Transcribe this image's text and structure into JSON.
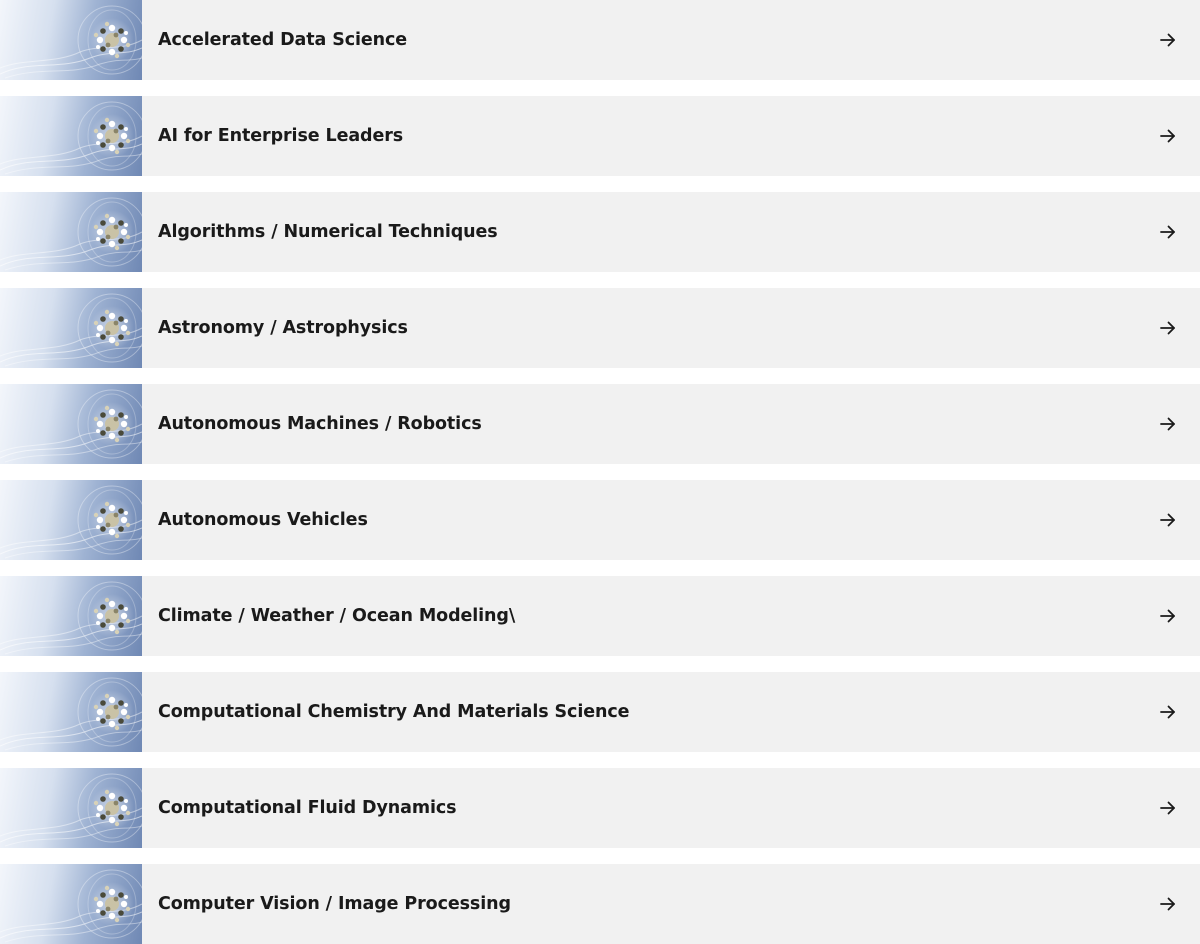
{
  "topics": [
    {
      "label": "Accelerated Data Science",
      "icon": "molecule-thumbnail",
      "action_icon": "arrow-right-icon"
    },
    {
      "label": "AI for Enterprise Leaders",
      "icon": "molecule-thumbnail",
      "action_icon": "arrow-right-icon"
    },
    {
      "label": "Algorithms / Numerical Techniques",
      "icon": "molecule-thumbnail",
      "action_icon": "arrow-right-icon"
    },
    {
      "label": "Astronomy / Astrophysics",
      "icon": "molecule-thumbnail",
      "action_icon": "arrow-right-icon"
    },
    {
      "label": "Autonomous Machines / Robotics",
      "icon": "molecule-thumbnail",
      "action_icon": "arrow-right-icon"
    },
    {
      "label": "Autonomous Vehicles",
      "icon": "molecule-thumbnail",
      "action_icon": "arrow-right-icon"
    },
    {
      "label": "Climate / Weather / Ocean Modeling\\",
      "icon": "molecule-thumbnail",
      "action_icon": "arrow-right-icon"
    },
    {
      "label": "Computational Chemistry And Materials Science",
      "icon": "molecule-thumbnail",
      "action_icon": "arrow-right-icon"
    },
    {
      "label": "Computational Fluid Dynamics",
      "icon": "molecule-thumbnail",
      "action_icon": "arrow-right-icon"
    },
    {
      "label": "Computer Vision / Image Processing",
      "icon": "molecule-thumbnail",
      "action_icon": "arrow-right-icon"
    }
  ],
  "colors": {
    "row_background": "#f1f1f1",
    "text": "#1a1a1a",
    "thumbnail_gradient_start": "#f3f6fb",
    "thumbnail_gradient_end": "#6f88b4"
  }
}
